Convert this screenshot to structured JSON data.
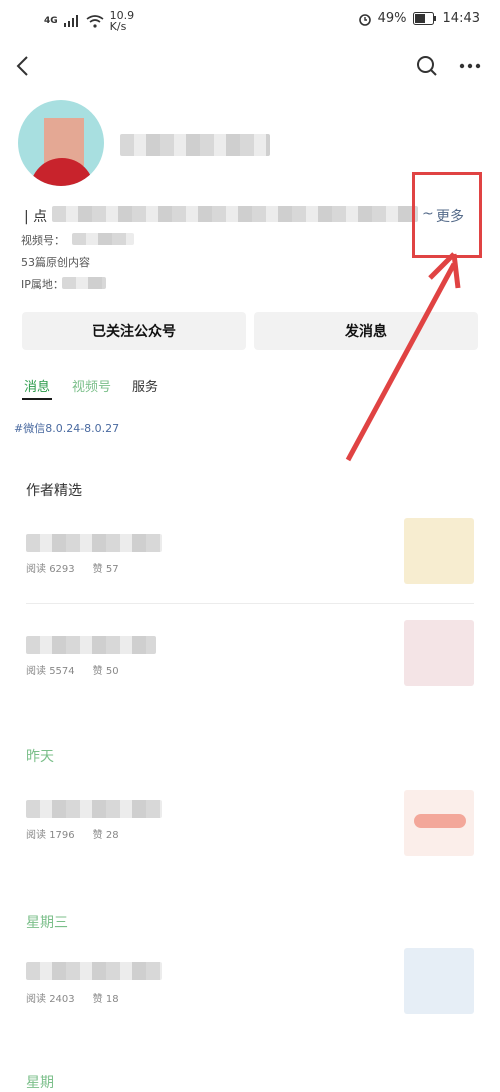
{
  "status_bar": {
    "network": "4G",
    "speed_value": "10.9",
    "speed_unit": "K/s",
    "battery": "49%",
    "time": "14:43"
  },
  "navbar": {
    "back_icon": "back-arrow-icon",
    "search_icon": "search-icon",
    "more_icon": "more-dots-icon"
  },
  "profile": {
    "intro_prefix": "| 点",
    "intro_suffix": "~",
    "more_label": "更多",
    "video_label": "视频号：",
    "original_count": "53篇原创内容",
    "ip_label": "IP属地："
  },
  "buttons": {
    "followed": "已关注公众号",
    "message": "发消息"
  },
  "tabs": [
    {
      "label": "消息"
    },
    {
      "label": "视频号"
    },
    {
      "label": "服务"
    }
  ],
  "tag": "#微信8.0.24-8.0.27",
  "sections": {
    "featured": "作者精选",
    "yesterday": "昨天",
    "wednesday": "星期三",
    "partial": "星期"
  },
  "articles": [
    {
      "read_label": "阅读",
      "read": "6293",
      "like_label": "赞",
      "likes": "57"
    },
    {
      "read_label": "阅读",
      "read": "5574",
      "like_label": "赞",
      "likes": "50"
    },
    {
      "read_label": "阅读",
      "read": "1796",
      "like_label": "赞",
      "likes": "28"
    },
    {
      "read_label": "阅读",
      "read": "2403",
      "like_label": "赞",
      "likes": "18"
    }
  ],
  "colors": {
    "accent_green": "#2a9a4a",
    "section_green": "#7bbf8a",
    "link_blue": "#556b8a",
    "annotation_red": "#e04343"
  }
}
